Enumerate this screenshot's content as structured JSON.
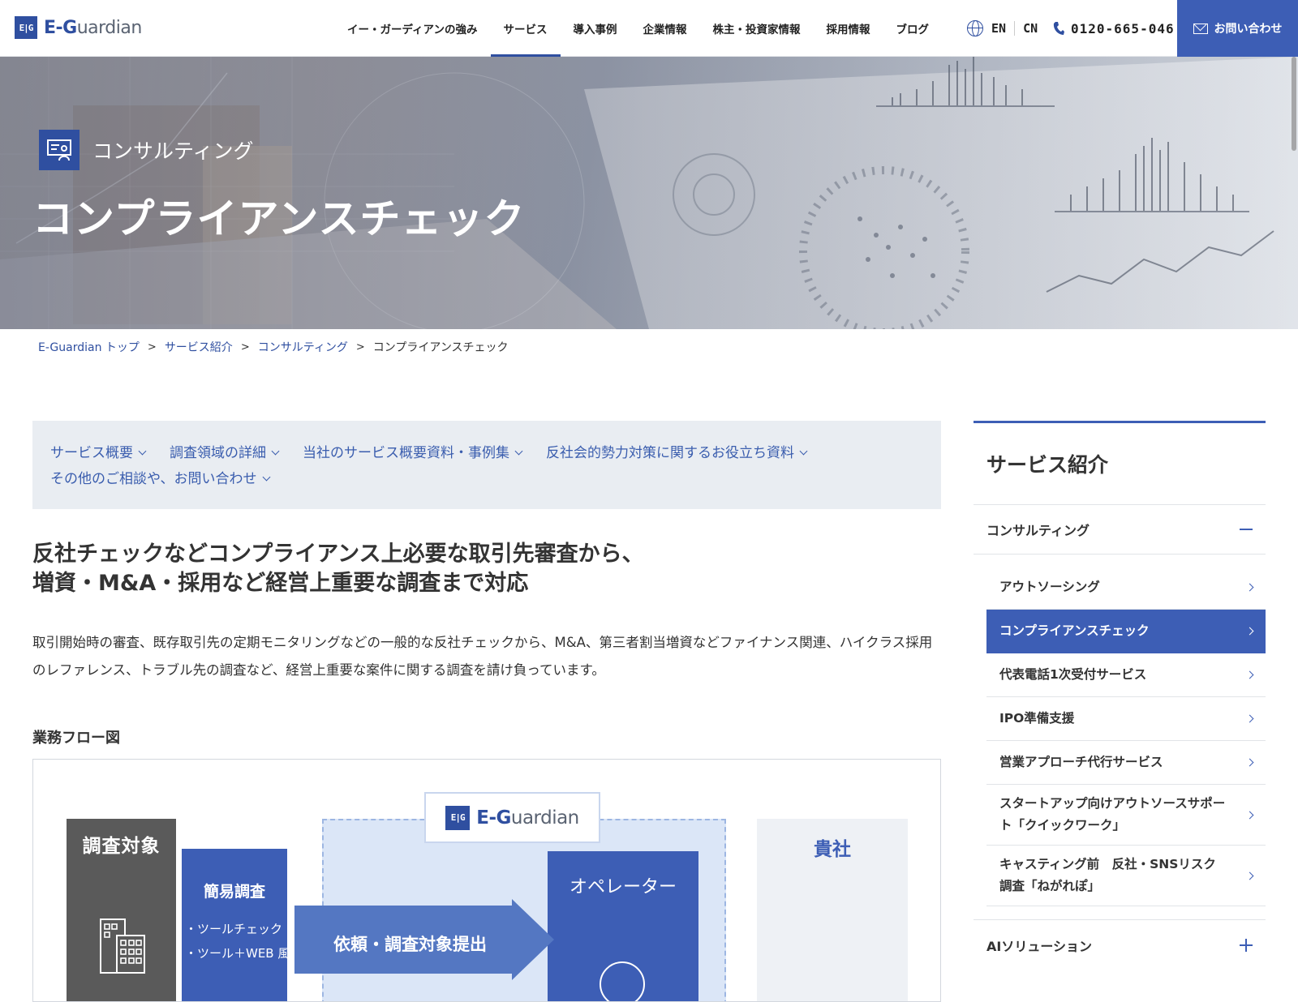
{
  "header": {
    "logo_mark": "E|G",
    "logo_text_prefix": "E-G",
    "logo_text_suffix": "uardian",
    "nav": [
      {
        "label": "イー・ガーディアンの強み",
        "active": false
      },
      {
        "label": "サービス",
        "active": true
      },
      {
        "label": "導入事例",
        "active": false
      },
      {
        "label": "企業情報",
        "active": false
      },
      {
        "label": "株主・投資家情報",
        "active": false
      },
      {
        "label": "採用情報",
        "active": false
      },
      {
        "label": "ブログ",
        "active": false
      }
    ],
    "lang_en": "EN",
    "lang_cn": "CN",
    "phone": "0120-665-046",
    "contact": "お問い合わせ"
  },
  "hero": {
    "category": "コンサルティング",
    "title": "コンプライアンスチェック"
  },
  "breadcrumb": {
    "items": [
      "E-Guardian トップ",
      "サービス紹介",
      "コンサルティング"
    ],
    "separator": ">",
    "current": "コンプライアンスチェック"
  },
  "anchors": [
    "サービス概要",
    "調査領域の詳細",
    "当社のサービス概要資料・事例集",
    "反社会的勢力対策に関するお役立ち資料",
    "その他のご相談や、お問い合わせ"
  ],
  "main": {
    "lead_line1": "反社チェックなどコンプライアンス上必要な取引先審査から、",
    "lead_line2": "増資・M&A・採用など経営上重要な調査まで対応",
    "description": "取引開始時の審査、既存取引先の定期モニタリングなどの一般的な反社チェックから、M&A、第三者割当増資などファイナンス関連、ハイクラス採用のレファレンス、トラブル先の調査など、経営上重要な案件に関する調査を請け負っています。",
    "flow_title": "業務フロー図"
  },
  "flow": {
    "target_label": "調査対象",
    "simple_label": "簡易調査",
    "simple_items": [
      "・ツールチェック",
      "・ツール＋WEB 風評"
    ],
    "eg_logo_prefix": "E-G",
    "eg_logo_suffix": "uardian",
    "arrow_label": "依頼・調査対象提出",
    "operator_label": "オペレーター",
    "client_label": "貴社"
  },
  "sidebar": {
    "title": "サービス紹介",
    "category": "コンサルティング",
    "items": [
      {
        "label": "アウトソーシング",
        "active": false
      },
      {
        "label": "コンプライアンスチェック",
        "active": true
      },
      {
        "label": "代表電話1次受付サービス",
        "active": false
      },
      {
        "label": "IPO準備支援",
        "active": false
      },
      {
        "label": "営業アプローチ代行サービス",
        "active": false
      },
      {
        "label": "スタートアップ向けアウトソースサポート「クイックワーク」",
        "active": false
      },
      {
        "label": "キャスティング前　反社・SNSリスク調査「ねがれぽ」",
        "active": false
      }
    ],
    "category2": "AIソリューション"
  },
  "colors": {
    "brand": "#2f4fa0",
    "accent": "#3d5eb5",
    "anchor_bg": "#e9edf2",
    "flow_area": "#dbe6f7"
  }
}
